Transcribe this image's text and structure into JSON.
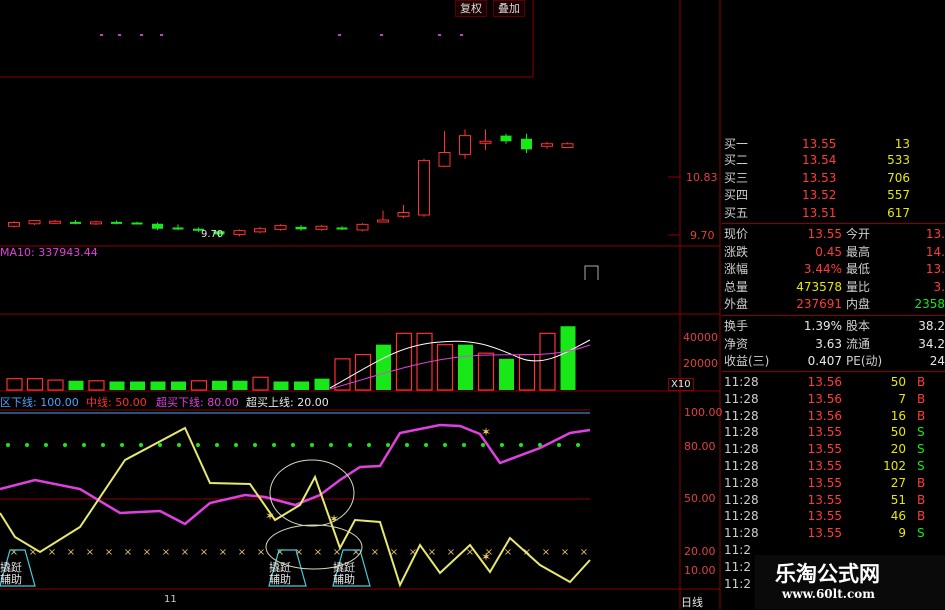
{
  "toolbar": {
    "restore_right_label": "复权",
    "overlay_label": "叠加"
  },
  "price_axis": {
    "upper": "10.83",
    "lower": "9.70",
    "low_marker": "9.70"
  },
  "ma_label": "MA10: 337943.44",
  "volume_axis": {
    "top": "40000",
    "bottom": "20000",
    "unit": "X10"
  },
  "indicator_header": {
    "items": [
      {
        "text": "区下线: 100.00",
        "color": "#4aa4ff"
      },
      {
        "text": "中线: 50.00",
        "color": "#ff3030"
      },
      {
        "text": "超买下线: 80.00",
        "color": "#e040e0"
      },
      {
        "text": "超买上线: 20.00",
        "color": "#e8e8e8"
      }
    ]
  },
  "indicator_axis": [
    "100.00",
    "80.00",
    "50.00",
    "20.00",
    "10.00"
  ],
  "indicator_tags": [
    "撬跹\n辅助",
    "撬跹\n辅助",
    "撬跹\n辅助"
  ],
  "bottom_bar": {
    "left_tick": "11",
    "period": "日线"
  },
  "order_book": [
    {
      "label": "买二",
      "price": "13.54",
      "vol": "533"
    },
    {
      "label": "买三",
      "price": "13.53",
      "vol": "706"
    },
    {
      "label": "买四",
      "price": "13.52",
      "vol": "557"
    },
    {
      "label": "买五",
      "price": "13.51",
      "vol": "617"
    }
  ],
  "order_book_partial": {
    "label": "买一",
    "price": "13.55",
    "vol": "13"
  },
  "quote": [
    {
      "l1": "现价",
      "v1": "13.55",
      "c1": "red",
      "l2": "今开",
      "v2": "13.",
      "c2": "red"
    },
    {
      "l1": "涨跌",
      "v1": "0.45",
      "c1": "red",
      "l2": "最高",
      "v2": "14.",
      "c2": "red"
    },
    {
      "l1": "涨幅",
      "v1": "3.44%",
      "c1": "red",
      "l2": "最低",
      "v2": "13.",
      "c2": "red"
    },
    {
      "l1": "总量",
      "v1": "473578",
      "c1": "yel",
      "l2": "量比",
      "v2": "3.",
      "c2": "red"
    },
    {
      "l1": "外盘",
      "v1": "237691",
      "c1": "red",
      "l2": "内盘",
      "v2": "2358",
      "c2": "grn"
    }
  ],
  "fundamentals": [
    {
      "l1": "换手",
      "v1": "1.39%",
      "l2": "股本",
      "v2": "38.2"
    },
    {
      "l1": "净资",
      "v1": "3.63",
      "l2": "流通",
      "v2": "34.2"
    },
    {
      "l1": "收益(三)",
      "v1": "0.407",
      "l2": "PE(动)",
      "v2": "24"
    }
  ],
  "ticks": [
    {
      "t": "11:28",
      "p": "13.56",
      "v": "50",
      "s": "B"
    },
    {
      "t": "11:28",
      "p": "13.56",
      "v": "7",
      "s": "B"
    },
    {
      "t": "11:28",
      "p": "13.56",
      "v": "16",
      "s": "B"
    },
    {
      "t": "11:28",
      "p": "13.55",
      "v": "50",
      "s": "S"
    },
    {
      "t": "11:28",
      "p": "13.55",
      "v": "20",
      "s": "S"
    },
    {
      "t": "11:28",
      "p": "13.55",
      "v": "102",
      "s": "S"
    },
    {
      "t": "11:28",
      "p": "13.55",
      "v": "27",
      "s": "B"
    },
    {
      "t": "11:28",
      "p": "13.55",
      "v": "51",
      "s": "B"
    },
    {
      "t": "11:28",
      "p": "13.55",
      "v": "46",
      "s": "B"
    },
    {
      "t": "11:28",
      "p": "13.55",
      "v": "9",
      "s": "S"
    }
  ],
  "ticks_partial": [
    "11:2",
    "11:2",
    "11:2"
  ],
  "watermark": {
    "title": "乐淘公式网",
    "url": "www.60lt.com"
  },
  "colors": {
    "up": "#ff3030",
    "down": "#18e818",
    "grid": "#8a0000",
    "panel_label": "#cfcfcf"
  },
  "candles": [
    {
      "o": 9.9,
      "c": 9.96,
      "h": 9.98,
      "l": 9.88
    },
    {
      "o": 9.94,
      "c": 9.99,
      "h": 10.0,
      "l": 9.92
    },
    {
      "o": 9.97,
      "c": 9.98,
      "h": 10.0,
      "l": 9.94
    },
    {
      "o": 9.97,
      "c": 9.95,
      "h": 10.0,
      "l": 9.93
    },
    {
      "o": 9.94,
      "c": 9.97,
      "h": 9.99,
      "l": 9.92
    },
    {
      "o": 9.97,
      "c": 9.95,
      "h": 9.99,
      "l": 9.93
    },
    {
      "o": 9.96,
      "c": 9.95,
      "h": 9.97,
      "l": 9.93
    },
    {
      "o": 9.94,
      "c": 9.86,
      "h": 9.96,
      "l": 9.84
    },
    {
      "o": 9.88,
      "c": 9.87,
      "h": 9.93,
      "l": 9.84
    },
    {
      "o": 9.86,
      "c": 9.84,
      "h": 9.88,
      "l": 9.81
    },
    {
      "o": 9.82,
      "c": 9.77,
      "h": 9.84,
      "l": 9.72
    },
    {
      "o": 9.77,
      "c": 9.83,
      "h": 9.85,
      "l": 9.74
    },
    {
      "o": 9.81,
      "c": 9.86,
      "h": 9.89,
      "l": 9.79
    },
    {
      "o": 9.85,
      "c": 9.91,
      "h": 9.93,
      "l": 9.83
    },
    {
      "o": 9.89,
      "c": 9.85,
      "h": 9.92,
      "l": 9.83
    },
    {
      "o": 9.85,
      "c": 9.9,
      "h": 9.92,
      "l": 9.83
    },
    {
      "o": 9.88,
      "c": 9.86,
      "h": 9.9,
      "l": 9.84
    },
    {
      "o": 9.84,
      "c": 9.93,
      "h": 9.95,
      "l": 9.82
    },
    {
      "o": 10.0,
      "c": 10.0,
      "h": 10.15,
      "l": 9.96
    },
    {
      "o": 10.06,
      "c": 10.12,
      "h": 10.24,
      "l": 10.03
    },
    {
      "o": 10.08,
      "c": 10.95,
      "h": 10.98,
      "l": 10.05
    },
    {
      "o": 10.86,
      "c": 11.08,
      "h": 11.42,
      "l": 10.85
    },
    {
      "o": 11.05,
      "c": 11.35,
      "h": 11.45,
      "l": 10.98
    },
    {
      "o": 11.25,
      "c": 11.26,
      "h": 11.45,
      "l": 11.12
    },
    {
      "o": 11.35,
      "c": 11.26,
      "h": 11.38,
      "l": 11.22
    },
    {
      "o": 11.3,
      "c": 11.13,
      "h": 11.38,
      "l": 11.07
    },
    {
      "o": 11.18,
      "c": 11.22,
      "h": 11.25,
      "l": 11.14
    },
    {
      "o": 11.16,
      "c": 11.22,
      "h": 11.24,
      "l": 11.15
    }
  ],
  "volumes": [
    {
      "v": 8000,
      "up": true
    },
    {
      "v": 8000,
      "up": true
    },
    {
      "v": 7000,
      "up": true
    },
    {
      "v": 6500,
      "up": false
    },
    {
      "v": 6500,
      "up": true
    },
    {
      "v": 6000,
      "up": false
    },
    {
      "v": 6000,
      "up": false
    },
    {
      "v": 6000,
      "up": false
    },
    {
      "v": 6000,
      "up": false
    },
    {
      "v": 6500,
      "up": true
    },
    {
      "v": 6500,
      "up": false
    },
    {
      "v": 6500,
      "up": false
    },
    {
      "v": 9000,
      "up": true
    },
    {
      "v": 6000,
      "up": false
    },
    {
      "v": 6000,
      "up": false
    },
    {
      "v": 8000,
      "up": false
    },
    {
      "v": 22000,
      "up": true
    },
    {
      "v": 25000,
      "up": true
    },
    {
      "v": 32000,
      "up": false
    },
    {
      "v": 40000,
      "up": true
    },
    {
      "v": 40000,
      "up": true
    },
    {
      "v": 32000,
      "up": true
    },
    {
      "v": 32000,
      "up": false
    },
    {
      "v": 26000,
      "up": true
    },
    {
      "v": 22000,
      "up": false
    },
    {
      "v": 25000,
      "up": true
    },
    {
      "v": 40000,
      "up": true
    },
    {
      "v": 45000,
      "up": false
    }
  ]
}
